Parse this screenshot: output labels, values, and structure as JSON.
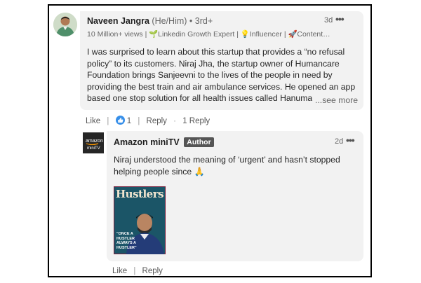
{
  "comment": {
    "author_name": "Naveen Jangra",
    "pronouns": "(He/Him)",
    "degree": " • 3rd+",
    "time": "3d",
    "more_icon": "ellipsis-icon",
    "headline": {
      "views": "10 Million+ views |",
      "growth": "Linkedin Growth Expert |",
      "influencer": "Influencer |",
      "content": "Content…"
    },
    "text": "I was surprised to learn about this startup that provides a “no refusal policy” to its customers. Niraj Jha, the startup owner of Humancare Foundation brings Sanjeevni to the lives of the people in need by providing the best train and air ambulance services. He opened an app based one stop solution for all health issues called Hanuman",
    "see_more": "...see more",
    "actions": {
      "like": "Like",
      "reaction_count": "1",
      "reply": "Reply",
      "reply_count": "1 Reply"
    }
  },
  "reply": {
    "author_name": "Amazon miniTV",
    "badge": "Author",
    "time": "2d",
    "more_icon": "ellipsis-icon",
    "avatar_logo_text": "amazon",
    "avatar_logo_sub": "miniTV",
    "text": "Niraj understood the meaning of ‘urgent’ and hasn’t stopped helping people since 🙏",
    "image": {
      "title": "Hustlers",
      "quote": "\"ONCE A HUSTLER ALWAYS A HUSTLER\""
    },
    "actions": {
      "like": "Like",
      "reply": "Reply"
    }
  },
  "colors": {
    "bubble": "#f2f2f2",
    "reaction_blue": "#378fe9",
    "badge_bg": "#555555"
  }
}
